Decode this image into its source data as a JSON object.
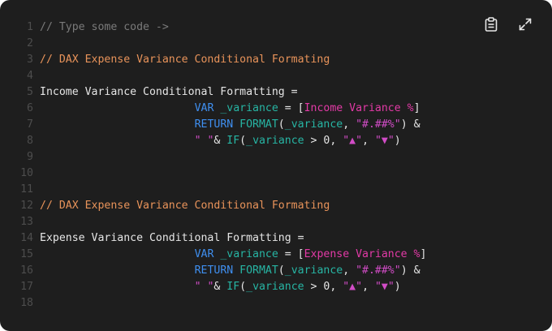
{
  "toolbar": {
    "copy_icon": "clipboard-icon",
    "expand_icon": "expand-icon"
  },
  "colors": {
    "background": "#1e1e1e",
    "line_number": "#4d4d4d",
    "comment": "#7a7a7a",
    "highlighted_comment": "#e8935a",
    "keyword": "#3f8ff0",
    "function": "#27b5a4",
    "reference": "#e23aa6",
    "string": "#d14cc6"
  },
  "lines": [
    {
      "n": "1",
      "tokens": [
        {
          "c": "comment",
          "t": "// Type some code ->"
        }
      ]
    },
    {
      "n": "2",
      "tokens": []
    },
    {
      "n": "3",
      "tokens": [
        {
          "c": "hl-comment",
          "t": "// DAX Expense Variance Conditional Formating"
        }
      ]
    },
    {
      "n": "4",
      "tokens": []
    },
    {
      "n": "5",
      "tokens": [
        {
          "c": "plain",
          "t": "Income Variance Conditional Formatting ="
        }
      ]
    },
    {
      "n": "6",
      "tokens": [
        {
          "c": "plain",
          "t": "                        "
        },
        {
          "c": "kw",
          "t": "VAR"
        },
        {
          "c": "plain",
          "t": " "
        },
        {
          "c": "var",
          "t": "_variance"
        },
        {
          "c": "op",
          "t": " = ["
        },
        {
          "c": "ref",
          "t": "Income Variance %"
        },
        {
          "c": "op",
          "t": "]"
        }
      ]
    },
    {
      "n": "7",
      "tokens": [
        {
          "c": "plain",
          "t": "                        "
        },
        {
          "c": "kw",
          "t": "RETURN"
        },
        {
          "c": "plain",
          "t": " "
        },
        {
          "c": "fn",
          "t": "FORMAT"
        },
        {
          "c": "op",
          "t": "("
        },
        {
          "c": "var",
          "t": "_variance"
        },
        {
          "c": "op",
          "t": ", "
        },
        {
          "c": "str",
          "t": "\"#.##%\""
        },
        {
          "c": "op",
          "t": ") &"
        }
      ]
    },
    {
      "n": "8",
      "tokens": [
        {
          "c": "plain",
          "t": "                        "
        },
        {
          "c": "str",
          "t": "\" \""
        },
        {
          "c": "op",
          "t": "& "
        },
        {
          "c": "fn",
          "t": "IF"
        },
        {
          "c": "op",
          "t": "("
        },
        {
          "c": "var",
          "t": "_variance"
        },
        {
          "c": "op",
          "t": " > 0, "
        },
        {
          "c": "str",
          "t": "\"▲\""
        },
        {
          "c": "op",
          "t": ", "
        },
        {
          "c": "str",
          "t": "\"▼\""
        },
        {
          "c": "op",
          "t": ")"
        }
      ]
    },
    {
      "n": "9",
      "tokens": []
    },
    {
      "n": "10",
      "tokens": []
    },
    {
      "n": "11",
      "tokens": []
    },
    {
      "n": "12",
      "tokens": [
        {
          "c": "hl-comment",
          "t": "// DAX Expense Variance Conditional Formating"
        }
      ]
    },
    {
      "n": "13",
      "tokens": []
    },
    {
      "n": "14",
      "tokens": [
        {
          "c": "plain",
          "t": "Expense Variance Conditional Formatting ="
        }
      ]
    },
    {
      "n": "15",
      "tokens": [
        {
          "c": "plain",
          "t": "                        "
        },
        {
          "c": "kw",
          "t": "VAR"
        },
        {
          "c": "plain",
          "t": " "
        },
        {
          "c": "var",
          "t": "_variance"
        },
        {
          "c": "op",
          "t": " = ["
        },
        {
          "c": "ref",
          "t": "Expense Variance %"
        },
        {
          "c": "op",
          "t": "]"
        }
      ]
    },
    {
      "n": "16",
      "tokens": [
        {
          "c": "plain",
          "t": "                        "
        },
        {
          "c": "kw",
          "t": "RETURN"
        },
        {
          "c": "plain",
          "t": " "
        },
        {
          "c": "fn",
          "t": "FORMAT"
        },
        {
          "c": "op",
          "t": "("
        },
        {
          "c": "var",
          "t": "_variance"
        },
        {
          "c": "op",
          "t": ", "
        },
        {
          "c": "str",
          "t": "\"#.##%\""
        },
        {
          "c": "op",
          "t": ") &"
        }
      ]
    },
    {
      "n": "17",
      "tokens": [
        {
          "c": "plain",
          "t": "                        "
        },
        {
          "c": "str",
          "t": "\" \""
        },
        {
          "c": "op",
          "t": "& "
        },
        {
          "c": "fn",
          "t": "IF"
        },
        {
          "c": "op",
          "t": "("
        },
        {
          "c": "var",
          "t": "_variance"
        },
        {
          "c": "op",
          "t": " > 0, "
        },
        {
          "c": "str",
          "t": "\"▲\""
        },
        {
          "c": "op",
          "t": ", "
        },
        {
          "c": "str",
          "t": "\"▼\""
        },
        {
          "c": "op",
          "t": ")"
        }
      ]
    },
    {
      "n": "18",
      "tokens": []
    }
  ]
}
